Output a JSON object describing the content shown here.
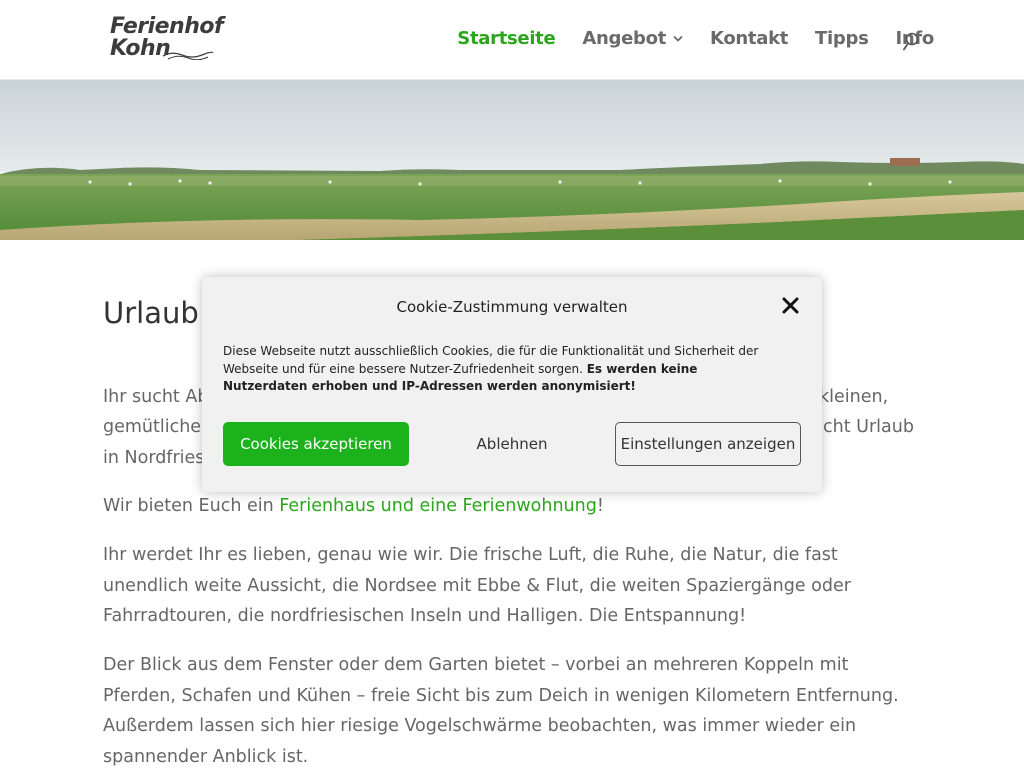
{
  "header": {
    "logo": {
      "line1": "Ferienhof",
      "line2": "Kohn"
    },
    "nav": [
      {
        "label": "Startseite",
        "active": true
      },
      {
        "label": "Angebot",
        "has_dropdown": true
      },
      {
        "label": "Kontakt"
      },
      {
        "label": "Tipps"
      },
      {
        "label": "Info"
      }
    ],
    "search_icon": "search-icon"
  },
  "hero": {
    "subject": "landscape-photo"
  },
  "main": {
    "title": "Urlaub",
    "paragraphs": {
      "p1_start": "Ihr sucht Ab",
      "p1_end": "kleinen,",
      "p1_line2_start": "gemütlicher",
      "p1_line2_end": "cht Urlaub",
      "p1_line3": "in Nordfriesl",
      "p2_before": "Wir bieten Euch ein ",
      "p2_link": "Ferienhaus und eine Ferienwohnung",
      "p2_after": "!",
      "p3": "Ihr werdet Ihr es lieben, genau wie wir. Die frische Luft, die Ruhe, die Natur, die fast unendlich weite Aussicht, die Nordsee mit Ebbe & Flut, die weiten Spaziergänge oder Fahrradtouren, die nordfriesischen Inseln und Halligen. Die Entspannung!",
      "p4": "Der Blick aus dem Fenster oder dem Garten bietet – vorbei an mehreren Koppeln mit Pferden, Schafen und Kühen – freie Sicht bis zum Deich in wenigen Kilometern Entfernung. Außerdem lassen sich hier riesige Vogelschwärme beobachten, was immer wieder ein spannender Anblick ist."
    }
  },
  "cookie_dialog": {
    "title": "Cookie-Zustimmung verwalten",
    "text": "Diese Webseite nutzt ausschließlich Cookies, die für die Funktionalität und Sicherheit der Webseite und für eine bessere Nutzer-Zufriedenheit sorgen. ",
    "text_bold": "Es werden keine Nutzerdaten erhoben und IP-Adressen werden anonymisiert!",
    "accept_label": "Cookies akzeptieren",
    "deny_label": "Ablehnen",
    "settings_label": "Einstellungen anzeigen",
    "close_icon": "close-icon"
  },
  "colors": {
    "accent": "#2aa61b",
    "accept_button": "#1bb21b",
    "dialog_bg": "#f1f1f1"
  }
}
